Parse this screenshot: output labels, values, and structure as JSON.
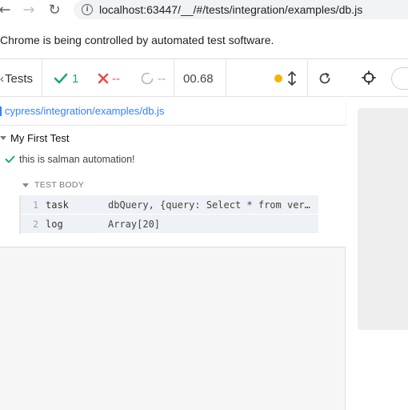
{
  "browser": {
    "url": "localhost:63447/__/#/tests/integration/examples/db.js"
  },
  "infobar": {
    "message": "Chrome is being controlled by automated test software."
  },
  "reporter": {
    "tests_label": "Tests",
    "passed": "1",
    "failed": "--",
    "pending": "--",
    "duration": "00.68",
    "spec_path": "cypress/integration/examples/db.js",
    "suite_title": "My First Test",
    "test_title": "this is salman automation!",
    "body_label": "TEST BODY",
    "commands": [
      {
        "number": "1",
        "name": "task",
        "message": "dbQuery, {query: Select * from ver…"
      },
      {
        "number": "2",
        "name": "log",
        "message": "Array[20]"
      }
    ]
  },
  "colors": {
    "passed": "#1fa971",
    "failed": "#e94f4f",
    "running_dot": "#f5b400",
    "link": "#3380ff"
  }
}
